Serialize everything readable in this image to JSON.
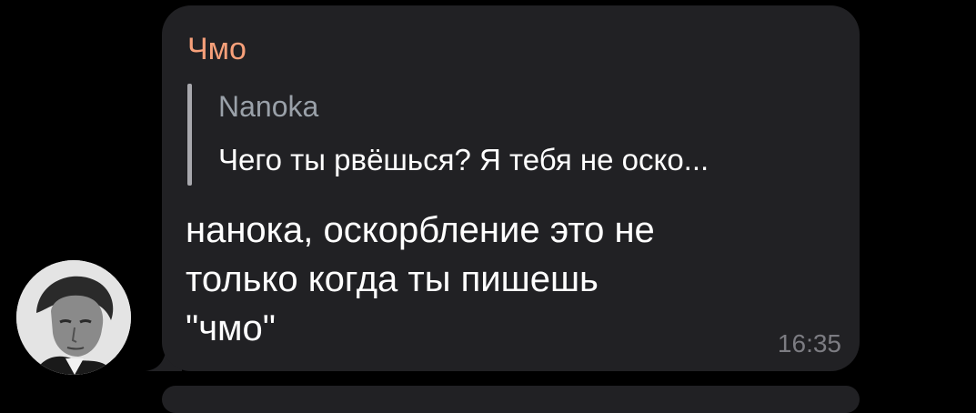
{
  "message": {
    "sender": "Чмо",
    "reply": {
      "author": "Nanoka",
      "text": "Чего ты рвёшься? Я тебя не оско..."
    },
    "lines": [
      "нанока, оскорбление это не",
      "только когда ты пишешь",
      "\"чмо\""
    ],
    "time": "16:35"
  },
  "colors": {
    "background": "#000000",
    "bubble": "#212124",
    "sender_name": "#f7a07a",
    "reply_author": "#9aa1a9",
    "text": "#ffffff",
    "timestamp": "#7c7c82"
  },
  "icons": {
    "avatar": "user-photo-avatar"
  }
}
